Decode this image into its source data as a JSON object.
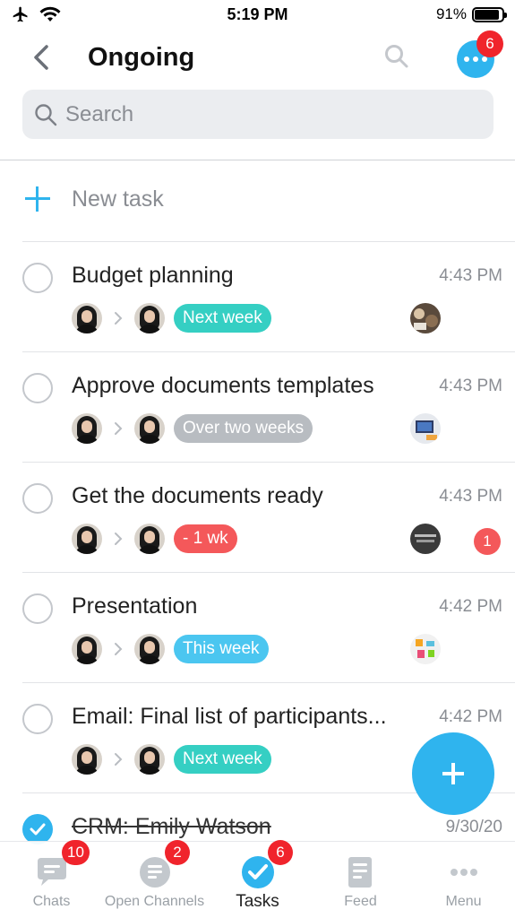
{
  "status_bar": {
    "time": "5:19 PM",
    "battery": "91%",
    "battery_level": 0.91,
    "icons": [
      "airplane-icon",
      "wifi-icon"
    ]
  },
  "header": {
    "title": "Ongoing",
    "more_badge": "6"
  },
  "search": {
    "placeholder": "Search"
  },
  "new_task": {
    "label": "New task"
  },
  "tasks": [
    {
      "title": "Budget planning",
      "time": "4:43 PM",
      "deadline": "Next week",
      "deadline_color": "#35cfc3",
      "completed": false
    },
    {
      "title": "Approve documents templates",
      "time": "4:43 PM",
      "deadline": "Over two weeks",
      "deadline_color": "#b8bcc1",
      "completed": false
    },
    {
      "title": "Get the documents ready",
      "time": "4:43 PM",
      "deadline": "- 1 wk",
      "deadline_color": "#f4585a",
      "completed": false,
      "badge": "1"
    },
    {
      "title": "Presentation",
      "time": "4:42 PM",
      "deadline": "This week",
      "deadline_color": "#4bc6f0",
      "completed": false
    },
    {
      "title": "Email: Final list of participants...",
      "time": "4:42 PM",
      "deadline": "Next week",
      "deadline_color": "#35cfc3",
      "completed": false
    },
    {
      "title": "CRM: Emily Watson",
      "time": "9/30/20",
      "completed": true
    }
  ],
  "tab_bar": {
    "tabs": [
      {
        "label": "Chats",
        "badge": "10",
        "icon": "chat-bubble-icon"
      },
      {
        "label": "Open Channels",
        "badge": "2",
        "icon": "channels-icon"
      },
      {
        "label": "Tasks",
        "badge": "6",
        "icon": "checkmark-icon",
        "active": true
      },
      {
        "label": "Feed",
        "icon": "feed-icon"
      },
      {
        "label": "Menu",
        "icon": "more-dots-icon"
      }
    ]
  },
  "colors": {
    "accent": "#2fb4ee",
    "badge_red": "#f0242c"
  }
}
